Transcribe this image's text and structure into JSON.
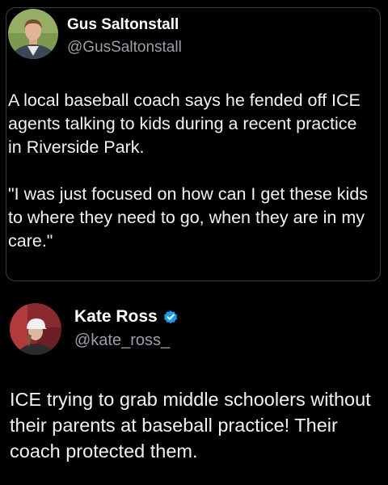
{
  "quoted_post": {
    "author": {
      "name": "Gus Saltonstall",
      "handle": "@GusSaltonstall",
      "avatar_icon": "profile-photo-man-suit"
    },
    "paragraphs": [
      "A local baseball coach says he fended off ICE agents talking to kids during a recent practice in Riverside Park.",
      "\"I was just focused on how can I get these kids to where they need to go, when they are in my care.\""
    ]
  },
  "post": {
    "author": {
      "name": "Kate Ross",
      "handle": "@kate_ross_",
      "verified": true,
      "avatar_icon": "profile-photo-woman-cap"
    },
    "text": "ICE trying to grab middle schoolers without their parents at baseball practice! Their coach protected them."
  },
  "colors": {
    "background": "#000000",
    "primary_text": "#f2f2f2",
    "secondary_text": "#9aa0a6",
    "verified_badge": "#1d9bf0",
    "card_border": "#3a3d40"
  }
}
